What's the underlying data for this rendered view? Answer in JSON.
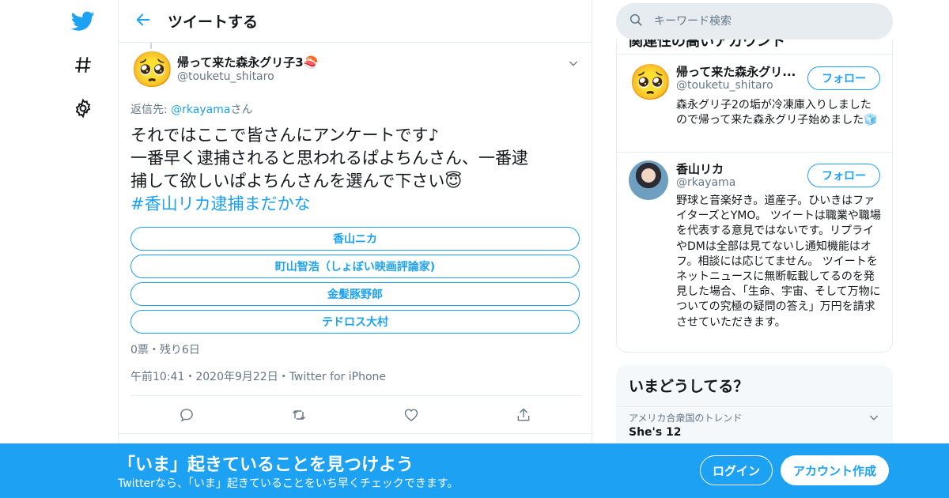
{
  "colors": {
    "accent": "#1da1f2",
    "secondary_text": "#657786",
    "border": "#e6ecf0"
  },
  "nav": {
    "items": [
      "twitter-logo-icon",
      "hashtag-icon",
      "gear-icon"
    ]
  },
  "header": {
    "title": "ツイートする"
  },
  "tweet": {
    "author_name": "帰って来た森永グリ子3🍣",
    "author_handle": "@touketu_shitaro",
    "reply_prefix": "返信先: ",
    "reply_mention": "@rkayama",
    "reply_suffix": "さん",
    "text_lines": [
      "それではここで皆さんにアンケートです♪",
      "一番早く逮捕されると思われるぱよちんさん、一番逮",
      "捕して欲しいぱよちんさんを選んで下さい😇"
    ],
    "hashtag": "#香山リカ逮捕まだかな",
    "poll_options": [
      "香山ニカ",
      "町山智浩（しょぼい映画評論家)",
      "金髪豚野郎",
      "テドロス大村"
    ],
    "poll_meta": "0票・残り6日",
    "timestamp": "午前10:41・2020年9月22日・Twitter for iPhone"
  },
  "search": {
    "placeholder": "キーワード検索"
  },
  "related": {
    "heading": "関連性の高いアカウント",
    "users": [
      {
        "name": "帰って来た森永グリ...",
        "handle": "@touketu_shitaro",
        "follow": "フォロー",
        "bio": "森永グリ子2の垢が冷凍庫入りしましたので帰って来た森永グリ子始めました🧊"
      },
      {
        "name": "香山リカ",
        "handle": "@rkayama",
        "follow": "フォロー",
        "bio": "野球と音楽好き。道産子。ひいきはファイターズとYMO。 ツイートは職業や職場を代表する意見ではないです。リプライやDMは全部は見てないし通知機能はオフ。相談には応じてません。 ツイートをネットニュースに無断転載してるのを発見した場合、「生命、宇宙、そして万物についての究極の疑問の答え」万円を請求させていただきます。"
      }
    ]
  },
  "trends": {
    "title": "いまどうしてる？",
    "location_label": "アメリカ合衆国のトレンド",
    "first_trend": "She's 12"
  },
  "banner": {
    "title": "「いま」起きていることを見つけよう",
    "subtitle": "Twitterなら、「いま」起きていることをいち早くチェックできます。",
    "login": "ログイン",
    "signup": "アカウント作成"
  }
}
